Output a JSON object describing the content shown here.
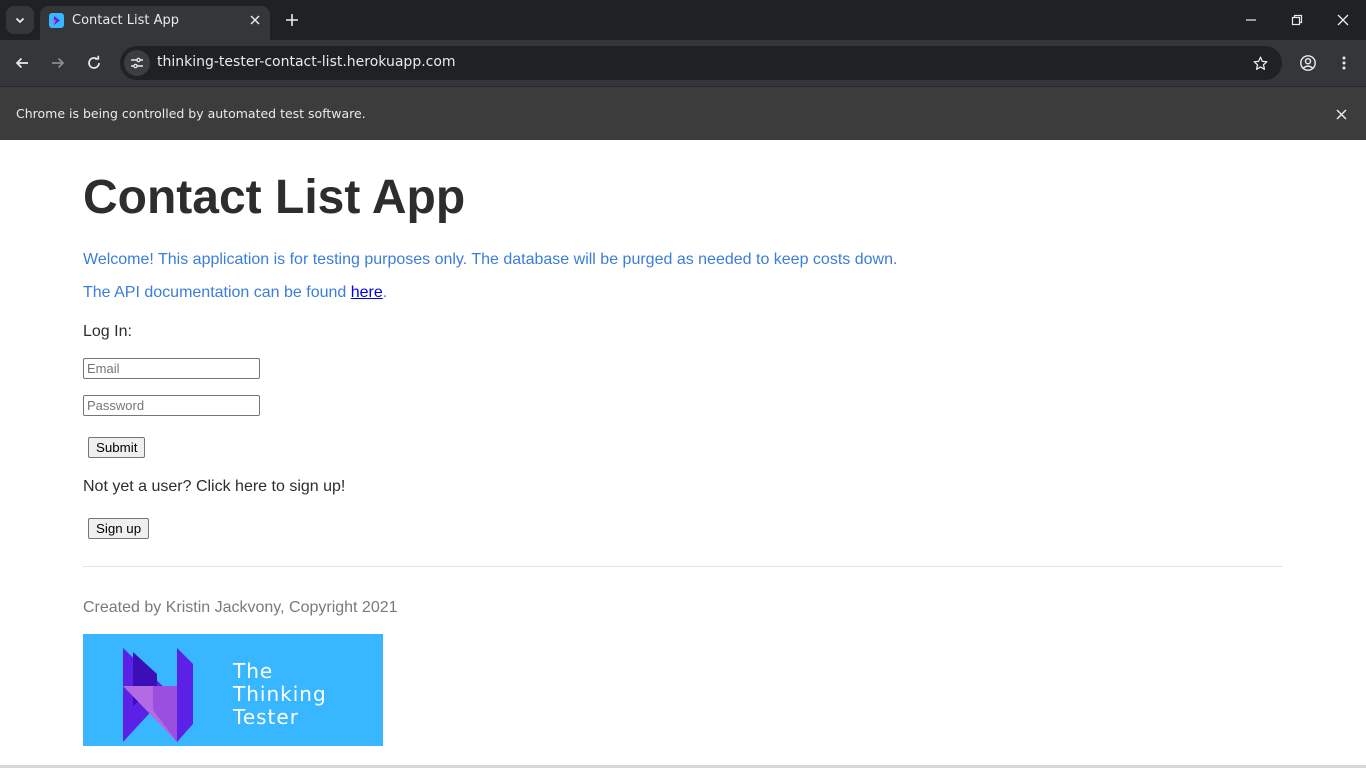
{
  "browser": {
    "tab_title": "Contact List App",
    "url": "thinking-tester-contact-list.herokuapp.com",
    "infobar_text": "Chrome is being controlled by automated test software."
  },
  "page": {
    "heading": "Contact List App",
    "welcome_text": "Welcome! This application is for testing purposes only. The database will be purged as needed to keep costs down.",
    "api_text_before": "The API documentation can be found ",
    "api_link": "here",
    "api_text_after": ".",
    "login_label": "Log In:",
    "email_placeholder": "Email",
    "password_placeholder": "Password",
    "submit_label": "Submit",
    "signup_prompt": "Not yet a user? Click here to sign up!",
    "signup_label": "Sign up",
    "footer_text": "Created by Kristin Jackvony, Copyright 2021",
    "logo_lines": [
      "The",
      "Thinking",
      "Tester"
    ]
  },
  "colors": {
    "accent_text": "#3b7ddd",
    "logo_bg": "#38b6ff",
    "logo_mark_dark": "#5b21e6",
    "logo_mark_light": "#b36ae2"
  }
}
